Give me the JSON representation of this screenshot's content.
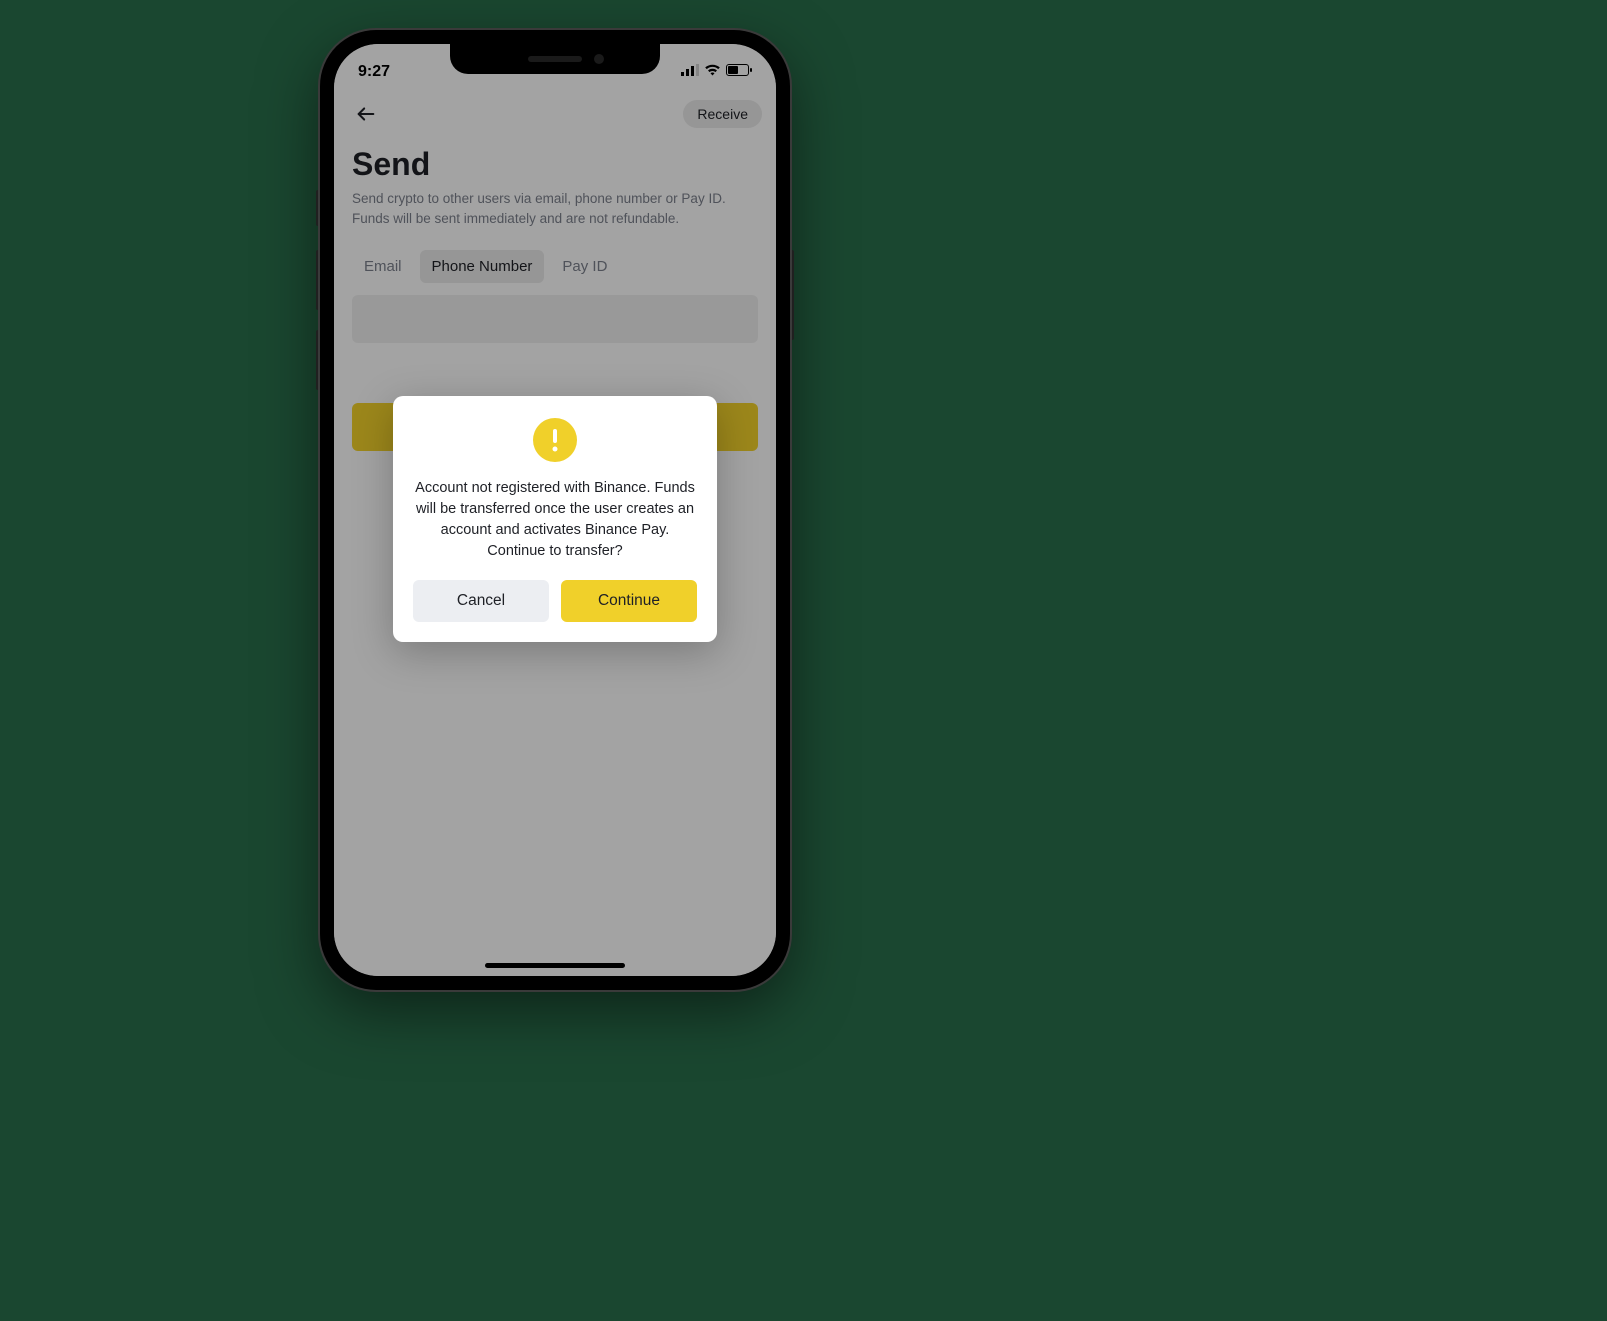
{
  "status_bar": {
    "time": "9:27"
  },
  "nav": {
    "receive_label": "Receive"
  },
  "page": {
    "title": "Send",
    "subtitle": "Send crypto to other users via email, phone number or Pay ID. Funds will be sent immediately and are not refundable."
  },
  "tabs": {
    "email": "Email",
    "phone": "Phone Number",
    "payid": "Pay ID",
    "active": "phone"
  },
  "modal": {
    "message": "Account not registered with Binance. Funds will be transferred once the user creates an account and activates Binance Pay. Continue to transfer?",
    "cancel_label": "Cancel",
    "continue_label": "Continue"
  },
  "colors": {
    "accent": "#f0d02a",
    "background_green": "#1a4730"
  }
}
